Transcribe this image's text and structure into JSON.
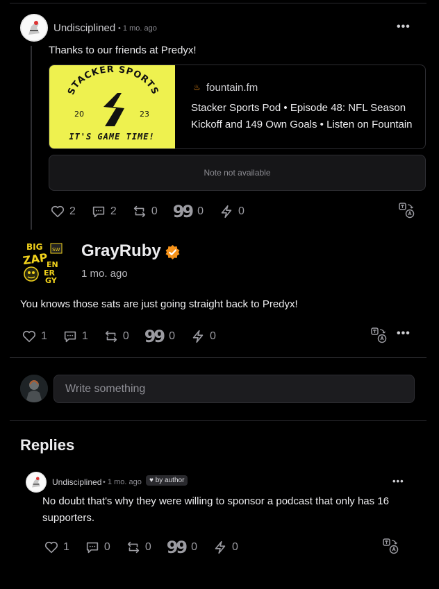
{
  "post1": {
    "author": "Undisciplined",
    "time": "1 mo. ago",
    "text": "Thanks to our friends at Predyx!",
    "link": {
      "domain": "fountain.fm",
      "title_line1": "Stacker Sports Pod • Episode 48: NFL Season",
      "title_line2": "Kickoff and 149 Own Goals • Listen on Fountain",
      "image_top": "STACKER SPORTS",
      "image_year_left": "20",
      "image_year_right": "23",
      "image_bottom": "IT'S GAME TIME!",
      "image_bg": "#eef14f"
    },
    "note_unavailable": "Note not available",
    "stats": {
      "likes": "2",
      "replies": "2",
      "reposts": "0",
      "quotes": "0",
      "zaps": "0"
    }
  },
  "post2": {
    "author": "GrayRuby",
    "time": "1 mo. ago",
    "text": "You knows those sats are just going straight back to Predyx!",
    "verified_color": "#f7931a",
    "avatar_words": [
      "BIG",
      "ZAP",
      "EN",
      "ER",
      "GY",
      "SW"
    ],
    "stats": {
      "likes": "1",
      "replies": "1",
      "reposts": "0",
      "quotes": "0",
      "zaps": "0"
    }
  },
  "composer": {
    "placeholder": "Write something"
  },
  "replies": {
    "heading": "Replies",
    "items": [
      {
        "author": "Undisciplined",
        "time": "1 mo. ago",
        "badge": "♥ by author",
        "text_line1": "No doubt that's why they were willing to sponsor a podcast that only has 16",
        "text_line2": "supporters.",
        "stats": {
          "likes": "1",
          "replies": "0",
          "reposts": "0",
          "quotes": "0",
          "zaps": "0"
        }
      }
    ]
  },
  "colors": {
    "background": "#000000",
    "accent": "#f7931a",
    "muted": "#9b9ba1"
  },
  "icons": [
    "heart-icon",
    "comment-icon",
    "repost-icon",
    "quote-icon",
    "zap-icon",
    "translate-icon",
    "more-icon",
    "verified-icon",
    "fountain-icon"
  ]
}
